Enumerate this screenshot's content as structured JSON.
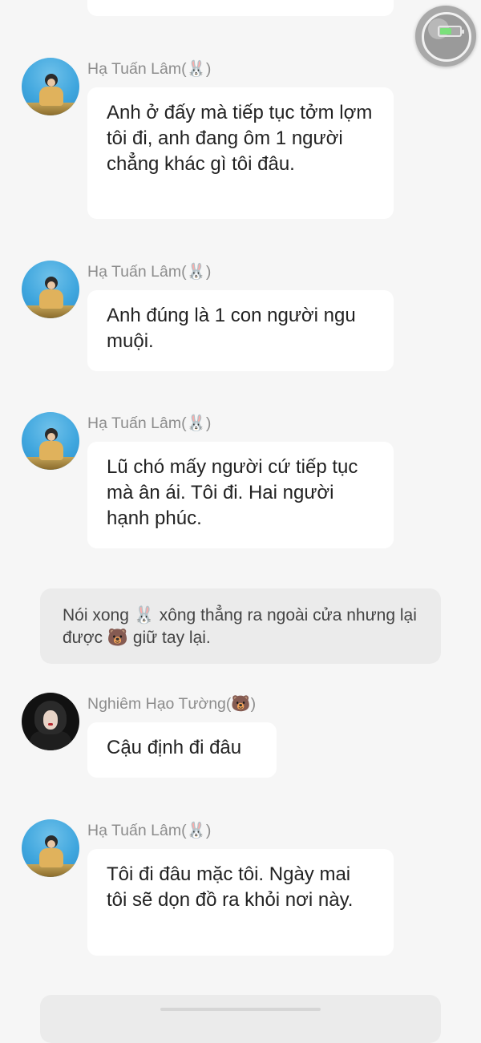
{
  "messages": [
    {
      "sender": "Hạ Tuấn Lâm(🐰)",
      "avatar": "ha",
      "text": "Anh ở đấy mà tiếp tục tởm lợm tôi đi, anh đang ôm 1 người chẳng khác gì tôi đâu."
    },
    {
      "sender": "Hạ Tuấn Lâm(🐰)",
      "avatar": "ha",
      "text": "Anh đúng là 1 con người ngu muội."
    },
    {
      "sender": "Hạ Tuấn Lâm(🐰)",
      "avatar": "ha",
      "text": "Lũ chó mấy người cứ tiếp tục mà ân ái. Tôi đi. Hai người hạnh phúc."
    },
    {
      "sender": "Nghiêm Hạo Tường(🐻)",
      "avatar": "nghiem",
      "text": "Cậu định đi đâu"
    },
    {
      "sender": "Hạ Tuấn Lâm(🐰)",
      "avatar": "ha",
      "text": "Tôi đi đâu mặc tôi. Ngày mai tôi sẽ dọn đồ ra khỏi nơi này."
    }
  ],
  "narration": "Nói xong 🐰 xông thẳng ra ngoài cửa nhưng lại được 🐻 giữ tay lại.",
  "battery": {
    "level": 0.6,
    "fill_color": "#7be07b",
    "charging": true
  },
  "icons": {
    "floating_ball": "assistive-touch-icon",
    "battery": "battery-charging-icon"
  }
}
